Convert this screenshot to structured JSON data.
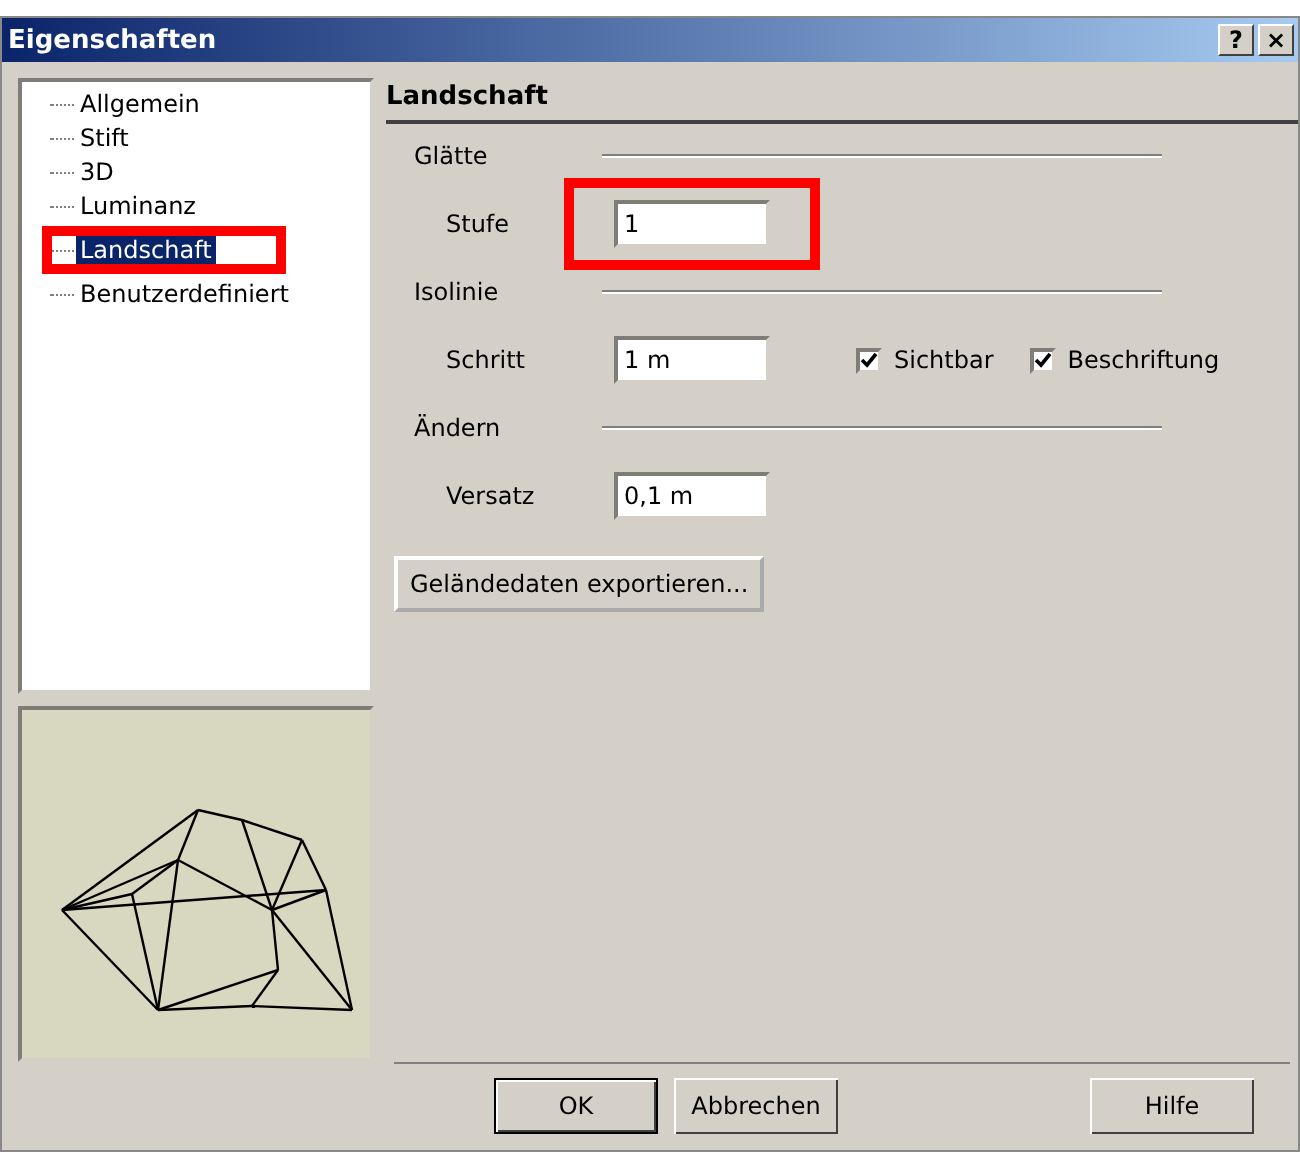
{
  "window": {
    "title": "Eigenschaften",
    "title_buttons": [
      "?",
      "×"
    ]
  },
  "tree": {
    "items": [
      {
        "label": "Allgemein",
        "selected": false,
        "highlighted": false
      },
      {
        "label": "Stift",
        "selected": false,
        "highlighted": false
      },
      {
        "label": "3D",
        "selected": false,
        "highlighted": false
      },
      {
        "label": "Luminanz",
        "selected": false,
        "highlighted": false
      },
      {
        "label": "Landschaft",
        "selected": true,
        "highlighted": true
      },
      {
        "label": "Benutzerdefiniert",
        "selected": false,
        "highlighted": false
      }
    ]
  },
  "preview": {
    "kind": "wireframe"
  },
  "page": {
    "heading": "Landschaft",
    "groups": [
      {
        "title": "Glätte",
        "rows": [
          {
            "label": "Stufe",
            "value": "1",
            "highlighted": true,
            "checkboxes": []
          }
        ]
      },
      {
        "title": "Isolinie",
        "rows": [
          {
            "label": "Schritt",
            "value": "1 m",
            "highlighted": false,
            "checkboxes": [
              {
                "label": "Sichtbar",
                "checked": true
              },
              {
                "label": "Beschriftung",
                "checked": true
              }
            ]
          }
        ]
      },
      {
        "title": "Ändern",
        "rows": [
          {
            "label": "Versatz",
            "value": "0,1 m",
            "highlighted": false,
            "checkboxes": []
          }
        ]
      }
    ],
    "action_button": "Geländedaten exportieren..."
  },
  "buttons": [
    {
      "label": "OK",
      "default": true
    },
    {
      "label": "Abbrechen",
      "default": false
    },
    {
      "label": "Hilfe",
      "default": false
    }
  ]
}
